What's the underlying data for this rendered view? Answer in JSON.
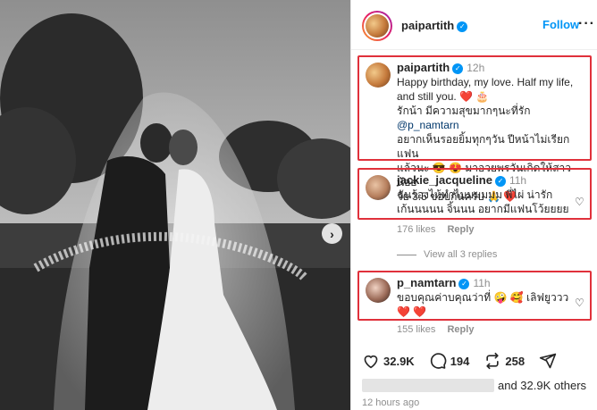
{
  "post": {
    "author": "paipartith",
    "follow_label": "Follow",
    "more_label": "···"
  },
  "caption": {
    "username": "paipartith",
    "time": "12h",
    "line1": "Happy birthday, my love. Half my life,",
    "line2": "and still you. ❤️ 🎂",
    "line3a": "รักน้า มีความสุขมากๆนะที่รัก ",
    "mention": "@p_namtarn",
    "line4": "อยากเห็นรอยยิ้มทุกๆวัน ปีหน้าไม่เรียกแฟน",
    "line5": "แล้วนะ 😎 😍 มาอวยพรวันเกิดให้สาวน้อย",
    "line6": "วัย 3.5 ขอบกันครับ 🙏 ❤️"
  },
  "comments": [
    {
      "username": "jackie_jacqueline",
      "time": "11h",
      "line1": "ฉันร้องไห้ทำไมมมมมม พี่ไผ่ น่ารัก",
      "line2": "เก้นนนนน จิ้นนน อยากมีแฟนโว้ยยยย",
      "likes": "176 likes",
      "reply": "Reply",
      "view_replies": "View all 3 replies"
    },
    {
      "username": "p_namtarn",
      "time": "11h",
      "line1": "ขอบคุณค่าบคุณว่าที่ 🤪 🥰 เลิฟยูววว",
      "line2": "❤️ ❤️",
      "likes": "155 likes",
      "reply": "Reply"
    }
  ],
  "actions": {
    "like_count": "32.9K",
    "comment_count": "194",
    "repost_count": "258"
  },
  "likes_text": "and 32.9K others",
  "posted_ago": "12 hours ago",
  "icons": [
    "verified-badge-icon",
    "chevron-right-icon",
    "heart-icon",
    "comment-icon",
    "repost-icon",
    "share-icon",
    "more-icon"
  ]
}
